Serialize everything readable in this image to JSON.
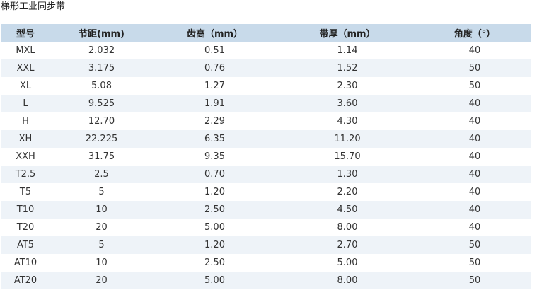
{
  "page": {
    "title": "梯形工业同步带"
  },
  "table": {
    "headers": [
      "型号",
      "节距(mm)",
      "齿高（mm）",
      "带厚（mm）",
      "角度（°）"
    ],
    "rows": [
      [
        "MXL",
        "2.032",
        "0.51",
        "1.14",
        "40"
      ],
      [
        "XXL",
        "3.175",
        "0.76",
        "1.52",
        "50"
      ],
      [
        "XL",
        "5.08",
        "1.27",
        "2.30",
        "50"
      ],
      [
        "L",
        "9.525",
        "1.91",
        "3.60",
        "40"
      ],
      [
        "H",
        "12.70",
        "2.29",
        "4.30",
        "40"
      ],
      [
        "XH",
        "22.225",
        "6.35",
        "11.20",
        "40"
      ],
      [
        "XXH",
        "31.75",
        "9.35",
        "15.70",
        "40"
      ],
      [
        "T2.5",
        "2.5",
        "0.70",
        "1.30",
        "40"
      ],
      [
        "T5",
        "5",
        "1.20",
        "2.20",
        "40"
      ],
      [
        "T10",
        "10",
        "2.50",
        "4.50",
        "40"
      ],
      [
        "T20",
        "20",
        "5.00",
        "8.00",
        "40"
      ],
      [
        "AT5",
        "5",
        "1.20",
        "2.70",
        "50"
      ],
      [
        "AT10",
        "10",
        "2.50",
        "5.00",
        "50"
      ],
      [
        "AT20",
        "20",
        "5.00",
        "8.00",
        "50"
      ]
    ]
  },
  "colors": {
    "header_background": "#c8daea",
    "stripe_background": "#eef3f8",
    "text": "#333333"
  }
}
